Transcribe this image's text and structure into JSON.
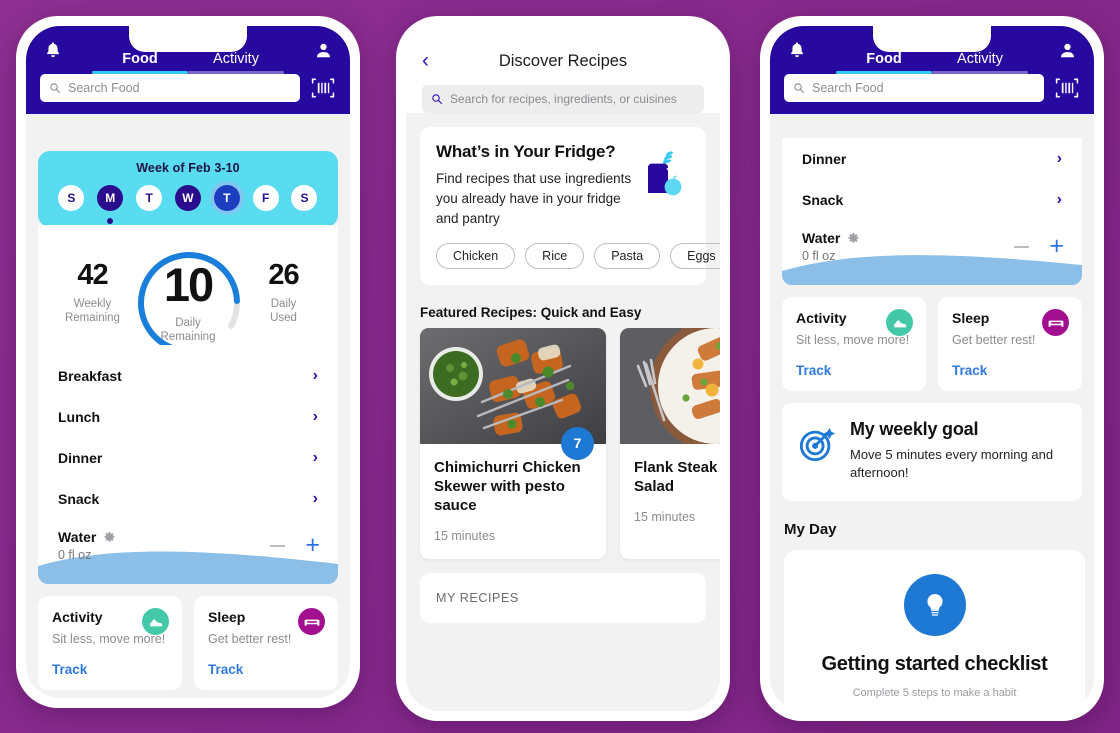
{
  "colors": {
    "background_purple": "#8a2d8f",
    "header_navy": "#2709a0",
    "accent_cyan": "#36c9f5",
    "week_strip_cyan": "#59dcf0",
    "ring_blue": "#1a7fdc",
    "link_blue": "#2f7ae0",
    "water_blue": "#8cbfe8",
    "activity_teal": "#44c9a8",
    "sleep_magenta": "#a3108f"
  },
  "phone1": {
    "header": {
      "bell_icon": "bell-icon",
      "profile_icon": "profile-icon",
      "barcode_icon": "barcode-scanner-icon",
      "tabs": [
        {
          "label": "Food",
          "active": true
        },
        {
          "label": "Activity",
          "active": false
        }
      ],
      "search": {
        "icon": "search-icon",
        "placeholder": "Search Food",
        "value": ""
      }
    },
    "week": {
      "title": "Week of Feb 3-10",
      "days": [
        {
          "label": "S",
          "state": "empty"
        },
        {
          "label": "M",
          "state": "filled"
        },
        {
          "label": "T",
          "state": "empty"
        },
        {
          "label": "W",
          "state": "filled"
        },
        {
          "label": "T",
          "state": "today"
        },
        {
          "label": "F",
          "state": "empty"
        },
        {
          "label": "S",
          "state": "empty"
        }
      ]
    },
    "stats": {
      "weekly": {
        "value": "42",
        "label_line1": "Weekly",
        "label_line2": "Remaining"
      },
      "daily_remaining": {
        "value": "10",
        "label_line1": "Daily",
        "label_line2": "Remaining"
      },
      "daily_used": {
        "value": "26",
        "label_line1": "Daily",
        "label_line2": "Used"
      },
      "ring_percent": 62
    },
    "meals": [
      {
        "label": "Breakfast"
      },
      {
        "label": "Lunch"
      },
      {
        "label": "Dinner"
      },
      {
        "label": "Snack"
      }
    ],
    "water": {
      "label": "Water",
      "gear_icon": "gear-icon",
      "amount": "0 fl oz",
      "minus_label": "−",
      "plus_label": "+"
    },
    "activity_card": {
      "title": "Activity",
      "subtitle": "Sit less, move more!",
      "cta": "Track",
      "icon": "shoe-icon"
    },
    "sleep_card": {
      "title": "Sleep",
      "subtitle": "Get better rest!",
      "cta": "Track",
      "icon": "bed-icon"
    }
  },
  "phone2": {
    "back_icon": "back-chevron-icon",
    "title": "Discover Recipes",
    "search": {
      "icon": "search-icon",
      "placeholder": "Search for recipes, ingredients, or cuisines",
      "value": ""
    },
    "fridge": {
      "heading": "What’s in Your Fridge?",
      "body": "Find recipes that use ingredients you already have in your fridge and pantry",
      "icon": "grocery-bag-icon",
      "chips": [
        "Chicken",
        "Rice",
        "Pasta",
        "Eggs"
      ]
    },
    "featured_section_title": "Featured Recipes: Quick and Easy",
    "recipes": [
      {
        "title": "Chimichurri Chicken Skewer with pesto sauce",
        "time": "15 minutes",
        "badge": "7",
        "photo": "grilled-chicken-skewers-photo"
      },
      {
        "title": "Flank Steak Citrus Salad",
        "time": "15 minutes",
        "badge": "",
        "photo": "flank-steak-salad-photo"
      }
    ],
    "my_recipes_label": "MY RECIPES"
  },
  "phone3": {
    "header": {
      "bell_icon": "bell-icon",
      "profile_icon": "profile-icon",
      "barcode_icon": "barcode-scanner-icon",
      "tabs": [
        {
          "label": "Food",
          "active": true
        },
        {
          "label": "Activity",
          "active": false
        }
      ],
      "search": {
        "icon": "search-icon",
        "placeholder": "Search Food",
        "value": ""
      }
    },
    "meals": [
      {
        "label": "Dinner"
      },
      {
        "label": "Snack"
      }
    ],
    "water": {
      "label": "Water",
      "gear_icon": "gear-icon",
      "amount": "0 fl oz",
      "minus_label": "−",
      "plus_label": "+"
    },
    "activity_card": {
      "title": "Activity",
      "subtitle": "Sit less, move more!",
      "cta": "Track",
      "icon": "shoe-icon"
    },
    "sleep_card": {
      "title": "Sleep",
      "subtitle": "Get better rest!",
      "cta": "Track",
      "icon": "bed-icon"
    },
    "weekly_goal": {
      "title": "My weekly goal",
      "body": "Move 5 minutes every morning and afternoon!",
      "icon": "target-icon"
    },
    "my_day_title": "My Day",
    "checklist": {
      "icon": "lightbulb-icon",
      "title": "Getting started checklist",
      "subtitle": "Complete 5 steps to make a habit"
    }
  }
}
